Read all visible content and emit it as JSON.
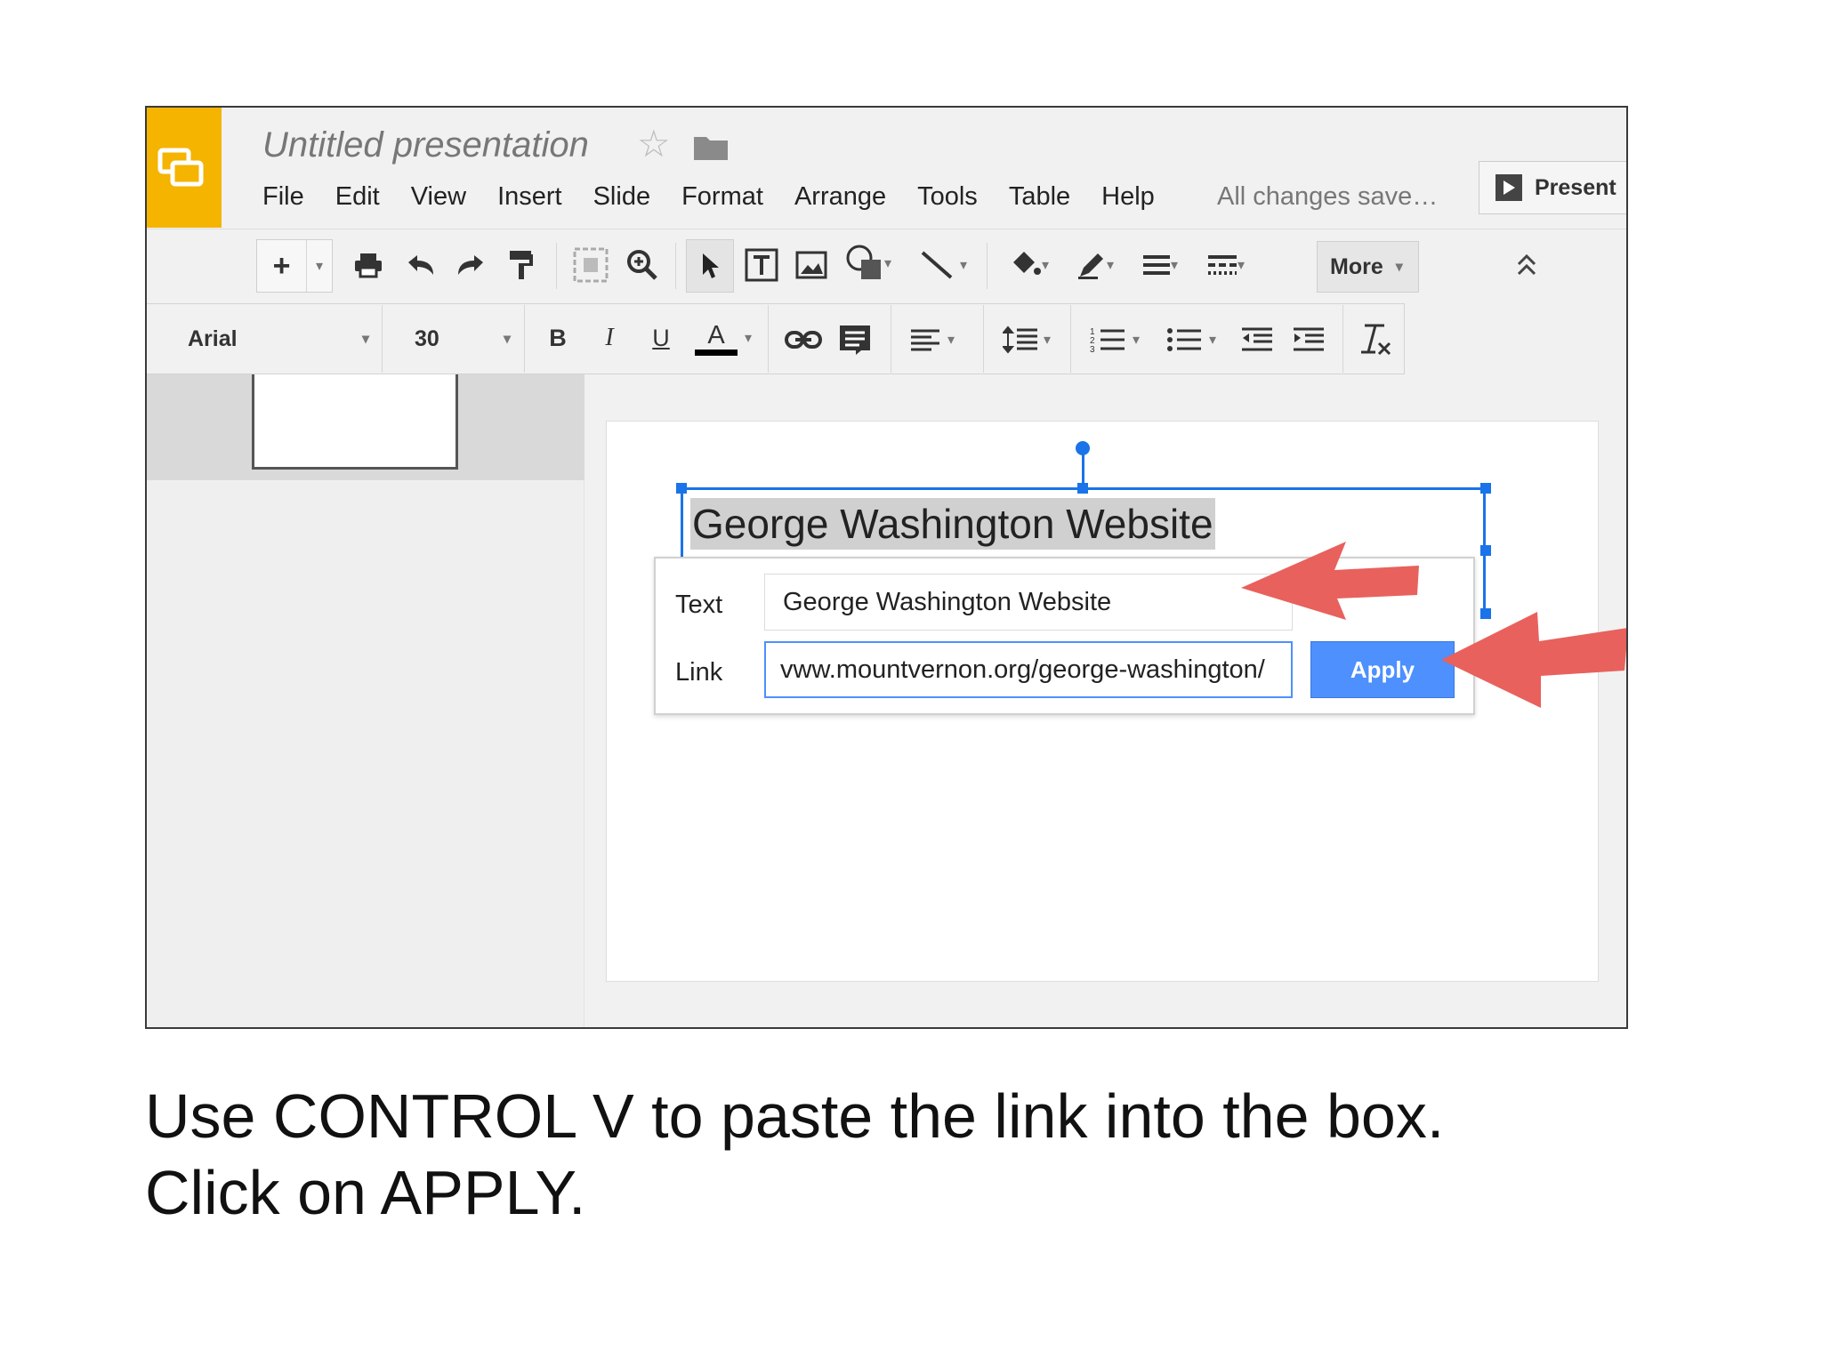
{
  "app": {
    "title": "Untitled presentation",
    "menu": [
      "File",
      "Edit",
      "View",
      "Insert",
      "Slide",
      "Format",
      "Arrange",
      "Tools",
      "Table",
      "Help"
    ],
    "save_status": "All changes save…",
    "present_label": "Present",
    "brand_color": "#f4b400"
  },
  "toolbar": {
    "more_label": "More",
    "font_name": "Arial",
    "font_size": "30",
    "bold": "B",
    "italic": "I",
    "underline": "U",
    "text_color": "A",
    "icons": [
      "plus-icon",
      "print-icon",
      "undo-icon",
      "redo-icon",
      "paint-format-icon",
      "fit-icon",
      "zoom-icon",
      "select-icon",
      "textbox-icon",
      "image-icon",
      "shape-icon",
      "line-icon",
      "fill-color-icon",
      "border-color-icon",
      "border-weight-icon",
      "border-dash-icon",
      "collapse-icon",
      "link-icon",
      "comment-icon",
      "align-icon",
      "line-spacing-icon",
      "numbered-list-icon",
      "bulleted-list-icon",
      "decrease-indent-icon",
      "increase-indent-icon",
      "clear-formatting-icon"
    ]
  },
  "slide": {
    "heading": "George Washington Website",
    "selection_color": "#1a73e8"
  },
  "link_dialog": {
    "text_label": "Text",
    "text_value": "George Washington Website",
    "link_label": "Link",
    "link_value": "vww.mountvernon.org/george-washington/",
    "apply_label": "Apply",
    "apply_color": "#4d90fe"
  },
  "annotations": {
    "arrow_color": "#e8615d"
  },
  "caption": {
    "line1": "Use CONTROL V to paste the link into the box.",
    "line2": "Click on APPLY."
  }
}
